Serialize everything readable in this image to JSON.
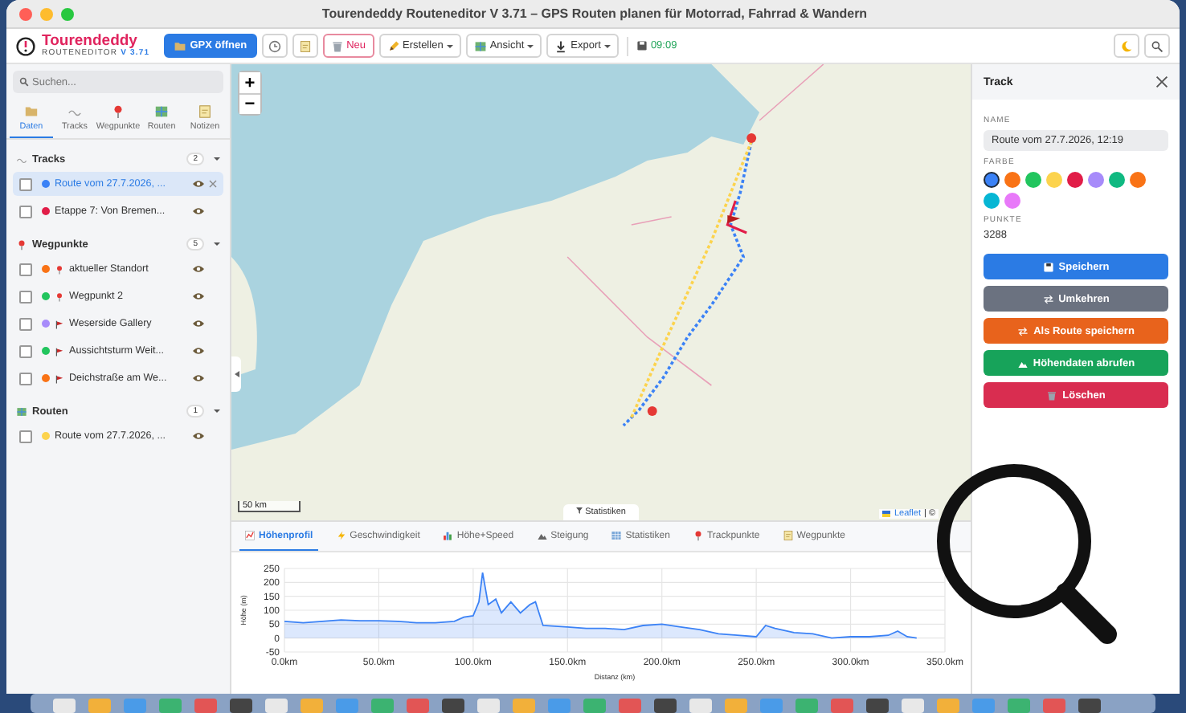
{
  "window": {
    "title": "Tourendeddy Routeneditor V 3.71 – GPS Routen planen für Motorrad, Fahrrad & Wandern"
  },
  "header": {
    "app_name": "Tourendeddy",
    "subtitle": "ROUTENEDITOR",
    "version": "V 3.71",
    "buttons": [
      {
        "kind": "primary",
        "label": "GPX öffnen",
        "menu": false
      },
      {
        "kind": "icon",
        "menu": false
      },
      {
        "kind": "icon",
        "menu": false
      },
      {
        "kind": "danger",
        "label": "Neu",
        "menu": false
      },
      {
        "kind": "plain",
        "label": "Erstellen",
        "menu": true
      },
      {
        "kind": "plain",
        "label": "Ansicht",
        "menu": true
      },
      {
        "kind": "plain",
        "label": "Export",
        "menu": true
      }
    ],
    "autosave": "09:09"
  },
  "sidebar": {
    "search": {
      "placeholder": "Suchen..."
    },
    "tabs": [
      {
        "label": "Daten",
        "selected": true
      },
      {
        "label": "Tracks",
        "selected": false
      },
      {
        "label": "Wegpunkte",
        "selected": false
      },
      {
        "label": "Routen",
        "selected": false
      },
      {
        "label": "Notizen",
        "selected": false
      }
    ],
    "sections": [
      {
        "title": "Tracks",
        "count": "2",
        "expanded": true,
        "items": [
          {
            "label": "Route vom 27.7.2026, ...",
            "color": "#3b82f6",
            "kind": "plain",
            "checked": false,
            "selected": true
          },
          {
            "label": "Etappe 7: Von Bremen...",
            "color": "#e11d48",
            "kind": "plain",
            "checked": false,
            "selected": false
          }
        ]
      },
      {
        "title": "Wegpunkte",
        "count": "5",
        "expanded": true,
        "items": [
          {
            "label": "aktueller Standort",
            "color": "#f97316",
            "kind": "pin",
            "checked": false,
            "selected": false
          },
          {
            "label": "Wegpunkt 2",
            "color": "#22c55e",
            "kind": "pin",
            "checked": false,
            "selected": false
          },
          {
            "label": "Weserside Gallery",
            "color": "#a78bfa",
            "kind": "flag",
            "checked": false,
            "selected": false
          },
          {
            "label": "Aussichtsturm Weit...",
            "color": "#22c55e",
            "kind": "flag",
            "checked": false,
            "selected": false
          },
          {
            "label": "Deichstraße am We...",
            "color": "#f97316",
            "kind": "flag",
            "checked": false,
            "selected": false
          }
        ]
      },
      {
        "title": "Routen",
        "count": "1",
        "expanded": true,
        "items": [
          {
            "label": "Route vom 27.7.2026, ...",
            "color": "#fcd34d",
            "kind": "plain",
            "checked": false,
            "selected": false
          }
        ]
      }
    ]
  },
  "map": {
    "zoom_in": "+",
    "zoom_out": "−",
    "scale": "50 km",
    "stats_toggle": "Statistiken",
    "attribution": "Leaflet",
    "attribution_rest": "| ©"
  },
  "bottom_tabs": [
    {
      "label": "Höhenprofil",
      "selected": true
    },
    {
      "label": "Geschwindigkeit",
      "selected": false
    },
    {
      "label": "Höhe+Speed",
      "selected": false
    },
    {
      "label": "Steigung",
      "selected": false
    },
    {
      "label": "Statistiken",
      "selected": false
    },
    {
      "label": "Trackpunkte",
      "selected": false
    },
    {
      "label": "Wegpunkte",
      "selected": false
    }
  ],
  "elevation": {
    "chart_data": {
      "type": "area",
      "xlabel": "Distanz (km)",
      "ylabel": "Höhe (m)",
      "grid": true,
      "x": [
        0,
        10,
        20,
        30,
        40,
        50,
        60,
        70,
        80,
        90,
        95,
        100,
        103,
        105,
        108,
        112,
        115,
        120,
        125,
        130,
        133,
        137,
        150,
        160,
        170,
        180,
        190,
        200,
        210,
        220,
        230,
        240,
        250,
        255,
        260,
        270,
        280,
        290,
        300,
        310,
        320,
        325,
        330,
        335
      ],
      "series": [
        {
          "color": "#3b82f6",
          "values": [
            60,
            55,
            60,
            65,
            62,
            62,
            60,
            55,
            55,
            60,
            75,
            80,
            130,
            235,
            120,
            140,
            90,
            130,
            90,
            120,
            130,
            45,
            40,
            35,
            35,
            30,
            45,
            50,
            40,
            30,
            15,
            10,
            5,
            45,
            35,
            20,
            15,
            0,
            5,
            5,
            10,
            25,
            5,
            0
          ]
        }
      ],
      "xlim": [
        0,
        350
      ],
      "ylim": [
        -50,
        250
      ],
      "xticks": [
        {
          "value": 0,
          "label": "0.0km"
        },
        {
          "value": 50,
          "label": "50.0km"
        },
        {
          "value": 100,
          "label": "100.0km"
        },
        {
          "value": 150,
          "label": "150.0km"
        },
        {
          "value": 200,
          "label": "200.0km"
        },
        {
          "value": 250,
          "label": "250.0km"
        },
        {
          "value": 300,
          "label": "300.0km"
        },
        {
          "value": 350,
          "label": "350.0km"
        }
      ],
      "yticks": [
        -50,
        0,
        50,
        100,
        150,
        200,
        250
      ]
    }
  },
  "panel": {
    "title": "Track",
    "name_label": "NAME",
    "name_value": "Route vom 27.7.2026, 12:19",
    "color_label": "FARBE",
    "swatches": [
      {
        "color": "#3b82f6",
        "selected": true
      },
      {
        "color": "#f97316",
        "selected": false
      },
      {
        "color": "#22c55e",
        "selected": false
      },
      {
        "color": "#fcd34d",
        "selected": false
      },
      {
        "color": "#e11d48",
        "selected": false
      },
      {
        "color": "#a78bfa",
        "selected": false
      },
      {
        "color": "#10b981",
        "selected": false
      },
      {
        "color": "#f97316",
        "selected": false
      },
      {
        "color": "#06b6d4",
        "selected": false
      },
      {
        "color": "#e879f9",
        "selected": false
      }
    ],
    "points_label": "PUNKTE",
    "points_value": "3288",
    "actions": [
      {
        "kind": "blue",
        "label": "Speichern"
      },
      {
        "kind": "gray",
        "label": "Umkehren"
      },
      {
        "kind": "orange",
        "label": "Als Route speichern"
      },
      {
        "kind": "green",
        "label": "Höhendaten abrufen"
      },
      {
        "kind": "red",
        "label": "Löschen"
      }
    ]
  }
}
